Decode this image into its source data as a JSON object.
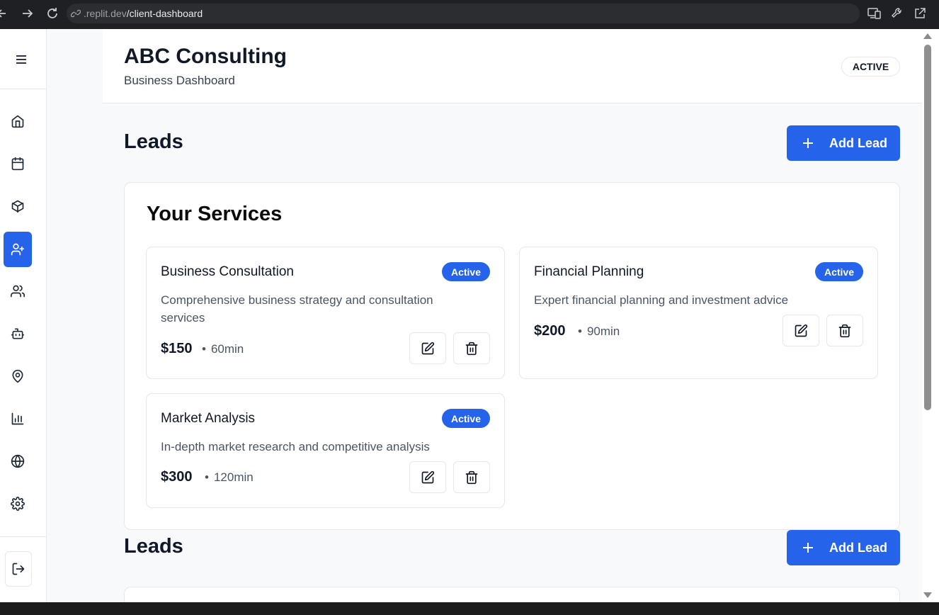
{
  "browser": {
    "url_prefix": ".replit.dev",
    "url_path": "/client-dashboard"
  },
  "sidebar": {
    "items": [
      {
        "icon": "home-icon",
        "active": false
      },
      {
        "icon": "calendar-icon",
        "active": false
      },
      {
        "icon": "package-icon",
        "active": false
      },
      {
        "icon": "user-plus-icon",
        "active": true
      },
      {
        "icon": "users-icon",
        "active": false
      },
      {
        "icon": "bot-icon",
        "active": false
      },
      {
        "icon": "map-pin-icon",
        "active": false
      },
      {
        "icon": "bar-chart-icon",
        "active": false
      },
      {
        "icon": "globe-icon",
        "active": false
      },
      {
        "icon": "settings-icon",
        "active": false
      }
    ],
    "logout_icon": "log-out-icon"
  },
  "header": {
    "title": "ABC Consulting",
    "subtitle": "Business Dashboard",
    "status": "ACTIVE"
  },
  "leads_section": {
    "title": "Leads",
    "add_label": "Add Lead"
  },
  "services": {
    "title": "Your Services",
    "items": [
      {
        "name": "Business Consultation",
        "status": "Active",
        "description": "Comprehensive business strategy and consultation services",
        "price": "$150",
        "duration": "60min"
      },
      {
        "name": "Financial Planning",
        "status": "Active",
        "description": "Expert financial planning and investment advice",
        "price": "$200",
        "duration": "90min"
      },
      {
        "name": "Market Analysis",
        "status": "Active",
        "description": "In-depth market research and competitive analysis",
        "price": "$300",
        "duration": "120min"
      }
    ]
  },
  "leads_section_2": {
    "title": "Leads",
    "add_label": "Add Lead"
  },
  "colors": {
    "accent": "#2563eb",
    "background": "#f8f9fb",
    "border": "#e5e7eb"
  }
}
